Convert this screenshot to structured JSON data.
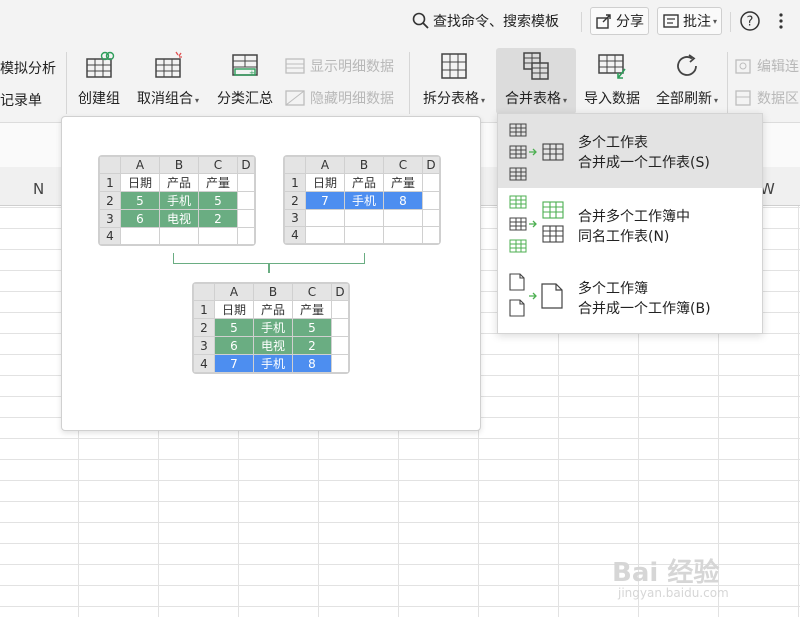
{
  "topbar": {
    "search_label": "查找命令、搜索模板",
    "share_label": "分享",
    "review_label": "批注",
    "help_icon": "help-circle-icon",
    "more_icon": "vertical-ellipsis-icon"
  },
  "ribbon": {
    "left_partial": {
      "what_if": "模拟分析",
      "record_form": "记录单"
    },
    "create_group": "创建组",
    "ungroup": "取消组合",
    "subtotal": "分类汇总",
    "show_detail": "显示明细数据",
    "hide_detail": "隐藏明细数据",
    "split_table": "拆分表格",
    "merge_table": "合并表格",
    "import_data": "导入数据",
    "refresh_all": "全部刷新",
    "edit_links": "编辑连",
    "data_area": "数据区"
  },
  "sheet": {
    "col_left": "N",
    "col_right": "W"
  },
  "preview": {
    "col_headers": [
      "A",
      "B",
      "C",
      "D"
    ],
    "table1": {
      "row_numbers": [
        "1",
        "2",
        "3",
        "4"
      ],
      "rows": [
        [
          "日期",
          "产品",
          "产量"
        ],
        [
          "5",
          "手机",
          "5"
        ],
        [
          "6",
          "电视",
          "2"
        ],
        [
          "",
          "",
          ""
        ]
      ]
    },
    "table2": {
      "row_numbers": [
        "1",
        "2",
        "3",
        "4"
      ],
      "rows": [
        [
          "日期",
          "产品",
          "产量"
        ],
        [
          "7",
          "手机",
          "8"
        ],
        [
          "",
          "",
          ""
        ],
        [
          "",
          "",
          ""
        ]
      ]
    },
    "result": {
      "row_numbers": [
        "1",
        "2",
        "3",
        "4"
      ],
      "rows": [
        [
          "日期",
          "产品",
          "产量"
        ],
        [
          "5",
          "手机",
          "5"
        ],
        [
          "6",
          "电视",
          "2"
        ],
        [
          "7",
          "手机",
          "8"
        ]
      ]
    },
    "colors": {
      "green": "#6aad82",
      "blue": "#4d8ef0"
    }
  },
  "menu": {
    "items": [
      {
        "line1": "多个工作表",
        "line2": "合并成一个工作表(S)",
        "highlighted": true
      },
      {
        "line1": "合并多个工作簿中",
        "line2": "同名工作表(N)",
        "highlighted": false
      },
      {
        "line1": "多个工作簿",
        "line2": "合并成一个工作簿(B)",
        "highlighted": false
      }
    ]
  },
  "watermark": {
    "main": "Bai 经验",
    "sub": "jingyan.baidu.com"
  }
}
